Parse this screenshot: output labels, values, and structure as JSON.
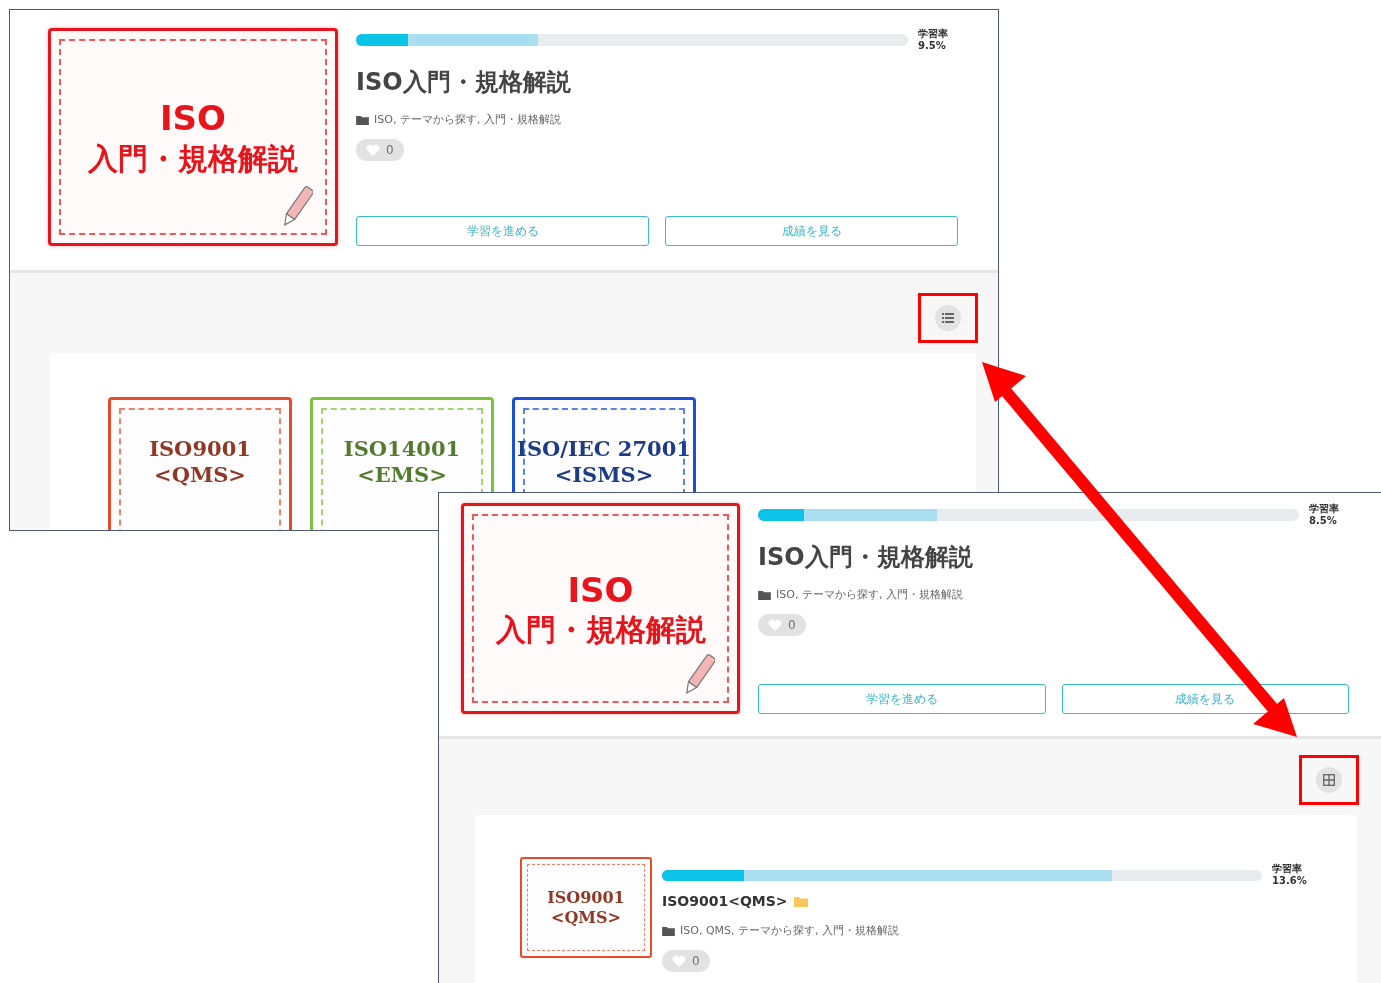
{
  "screens": [
    {
      "kind": "grid",
      "header": {
        "thumb_lines": [
          "ISO",
          "入門・規格解説"
        ],
        "color": "#e8141c",
        "bar": {
          "level": 0.095
        },
        "bar_buffer": {
          "level": 0.33
        },
        "rate_label": "学習率",
        "rate": "9.5%",
        "title": "ISO入門・規格解説",
        "tags": "ISO, テーマから探す, 入門・規格解説",
        "likes": "0",
        "buttons": [
          "学習を進める",
          "成績を見る"
        ]
      },
      "courses": [
        {
          "lines": [
            "ISO9001",
            "<QMS>"
          ],
          "color": "#e84a2a"
        },
        {
          "lines": [
            "ISO14001",
            "<EMS>"
          ],
          "color": "#7cc23a"
        },
        {
          "lines": [
            "ISO/IEC 27001",
            "<ISMS>"
          ],
          "color": "#1a4fd6"
        }
      ]
    },
    {
      "kind": "list",
      "header": {
        "thumb_lines": [
          "ISO",
          "入門・規格解説"
        ],
        "color": "#e8141c",
        "bar": {
          "level": 0.085
        },
        "bar_buffer": {
          "level": 0.33
        },
        "rate_label": "学習率",
        "rate": "8.5%",
        "title": "ISO入門・規格解説",
        "tags": "ISO, テーマから探す, 入門・規格解説",
        "likes": "0",
        "buttons": [
          "学習を進める",
          "成績を見る"
        ]
      },
      "courses": [
        {
          "lines": [
            "ISO9001",
            "<QMS>"
          ],
          "color": "#e84a2a",
          "title": "ISO9001<QMS>",
          "bar": {
            "level": 0.136
          },
          "bar_buffer": {
            "level": 0.75
          },
          "rate_label": "学習率",
          "rate": "13.6%",
          "tags": "ISO, QMS, テーマから探す, 入門・規格解説",
          "likes": "0"
        }
      ]
    }
  ]
}
